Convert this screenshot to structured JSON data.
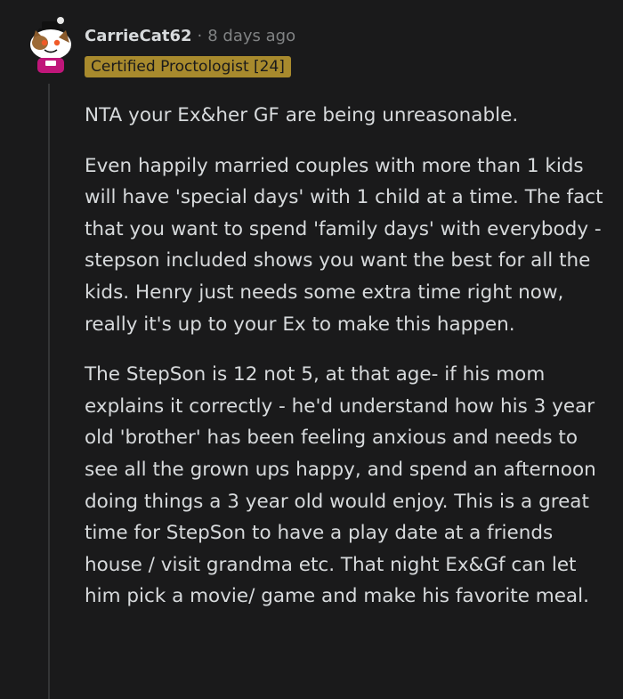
{
  "comment": {
    "username": "CarrieCat62",
    "separator": "·",
    "timestamp": "8 days ago",
    "flair": "Certified Proctologist [24]",
    "avatar_icon": "snoo-avatar-icon",
    "paragraphs": [
      "NTA your Ex&her GF are being unreasonable.",
      "Even happily married couples with more than 1 kids will have 'special days' with 1 child at a time. The fact that you want to spend 'family days' with everybody - stepson included shows you want the best for all the kids. Henry just needs some extra time right now, really it's up to your Ex to make this happen.",
      "The StepSon is 12 not 5, at that age- if his mom explains it correctly - he'd understand how his 3 year old 'brother' has been feeling anxious and needs to see all the grown ups happy, and spend an afternoon doing things a 3 year old would enjoy. This is a great time for StepSon to have a play date at a friends house / visit grandma etc. That night Ex&Gf can let him pick a movie/ game and make his favorite meal."
    ]
  },
  "colors": {
    "background": "#1a1a1b",
    "text": "#d7dadc",
    "meta": "#818384",
    "flair_bg": "#a88a2d",
    "thread_line": "#343536"
  }
}
